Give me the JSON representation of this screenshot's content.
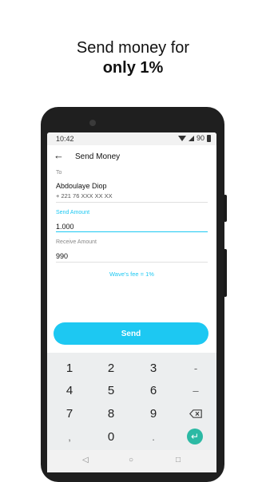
{
  "promo": {
    "line1": "Send money for",
    "line2": "only 1%"
  },
  "status": {
    "time": "10:42",
    "battery": "90"
  },
  "appbar": {
    "back_icon": "arrow-left-icon",
    "title": "Send Money"
  },
  "recipient": {
    "label": "To",
    "name": "Abdoulaye Diop",
    "phone": "+ 221 76 XXX XX XX"
  },
  "send_amount": {
    "label": "Send Amount",
    "value": "1.000"
  },
  "receive_amount": {
    "label": "Receive Amount",
    "value": "990"
  },
  "fee_text": "Wave's fee = 1%",
  "send_button": "Send",
  "keypad": {
    "keys": [
      "1",
      "2",
      "3",
      "-",
      "4",
      "5",
      "6",
      "–",
      "7",
      "8",
      "9",
      ",",
      "0",
      "."
    ]
  },
  "colors": {
    "accent": "#1dc8f2",
    "enter": "#2bb9a4"
  },
  "navbar": {
    "back": "◁",
    "home": "○",
    "recents": "□"
  }
}
